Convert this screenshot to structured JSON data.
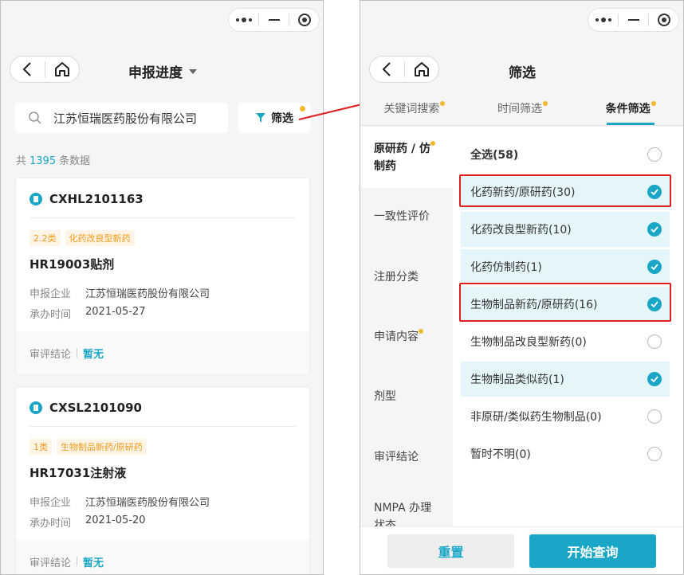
{
  "left_screen": {
    "title": "申报进度",
    "search_value": "江苏恒瑞医药股份有限公司",
    "filter_label": "筛选",
    "count": {
      "prefix": "共",
      "value": "1395",
      "suffix": "条数据"
    },
    "cards": [
      {
        "code": "CXHL2101163",
        "tags": [
          "2.2类",
          "化药改良型新药"
        ],
        "name": "HR19003贴剂",
        "company_label": "申报企业",
        "company": "江苏恒瑞医药股份有限公司",
        "date_label": "承办时间",
        "date": "2021-05-27",
        "conclusion_label": "审评结论",
        "conclusion": "暂无"
      },
      {
        "code": "CXSL2101090",
        "tags": [
          "1类",
          "生物制品新药/原研药"
        ],
        "name": "HR17031注射液",
        "company_label": "申报企业",
        "company": "江苏恒瑞医药股份有限公司",
        "date_label": "承办时间",
        "date": "2021-05-20",
        "conclusion_label": "审评结论",
        "conclusion": "暂无"
      }
    ]
  },
  "right_screen": {
    "title": "筛选",
    "tabs": [
      "关键词搜索",
      "时间筛选",
      "条件筛选"
    ],
    "sidebar": [
      {
        "line1": "原研药 / 仿",
        "line2": "制药"
      },
      {
        "line1": "一致性评价"
      },
      {
        "line1": "注册分类"
      },
      {
        "line1": "申请内容"
      },
      {
        "line1": "剂型"
      },
      {
        "line1": "审评结论"
      },
      {
        "line1": "NMPA 办理",
        "line2": "状态"
      }
    ],
    "options": [
      {
        "label": "全选(58)",
        "checked": false
      },
      {
        "label": "化药新药/原研药(30)",
        "checked": true
      },
      {
        "label": "化药改良型新药(10)",
        "checked": true
      },
      {
        "label": "化药仿制药(1)",
        "checked": true
      },
      {
        "label": "生物制品新药/原研药(16)",
        "checked": true
      },
      {
        "label": "生物制品改良型新药(0)",
        "checked": false
      },
      {
        "label": "生物制品类似药(1)",
        "checked": true
      },
      {
        "label": "非原研/类似药生物制品(0)",
        "checked": false
      },
      {
        "label": "暂时不明(0)",
        "checked": false
      }
    ],
    "reset_label": "重置",
    "search_label": "开始查询"
  },
  "colors": {
    "accent": "#1aa6c6",
    "tag": "#f29a1e",
    "badge_dot": "#f5b82e",
    "highlight": "#e02020"
  }
}
